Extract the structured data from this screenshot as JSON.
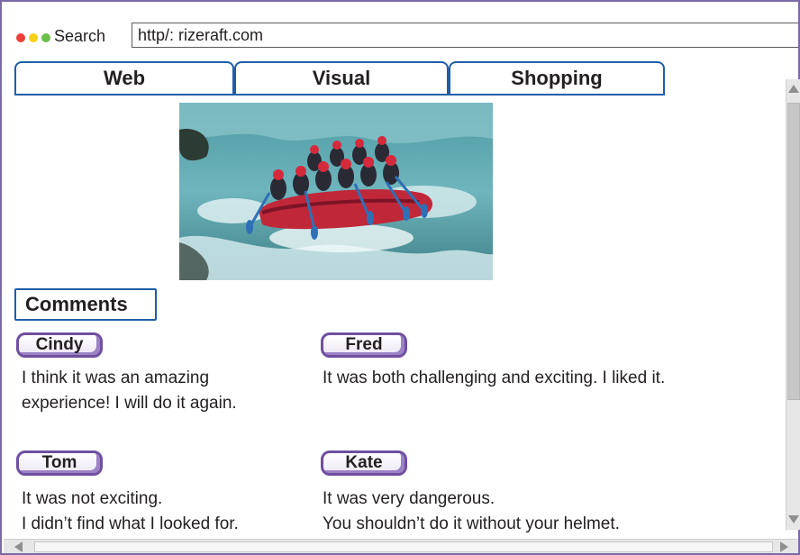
{
  "address_bar": {
    "search_label": "Search",
    "url": "http/: rizeraft.com"
  },
  "tabs": [
    {
      "label": "Web"
    },
    {
      "label": "Visual"
    },
    {
      "label": "Shopping"
    }
  ],
  "photo": {
    "icon": "rafting-photo"
  },
  "comments": {
    "header": "Comments",
    "items": [
      {
        "name": "Cindy",
        "lines": [
          "I think it was an amazing",
          "experience! I will do it again."
        ]
      },
      {
        "name": "Fred",
        "lines": [
          "It was both challenging and exciting. I liked it."
        ]
      },
      {
        "name": "Tom",
        "lines": [
          "It was not exciting.",
          "I didn’t find what I looked for."
        ]
      },
      {
        "name": "Kate",
        "lines": [
          "It was very dangerous.",
          "You shouldn’t do it without your helmet."
        ]
      }
    ]
  },
  "colors": {
    "window_border": "#7a6aa8",
    "tab_border": "#1f5ea8",
    "pill_border": "#6f4fa0",
    "dot_red": "#ee4036",
    "dot_yellow": "#f7d117",
    "dot_green": "#6cc04a"
  }
}
